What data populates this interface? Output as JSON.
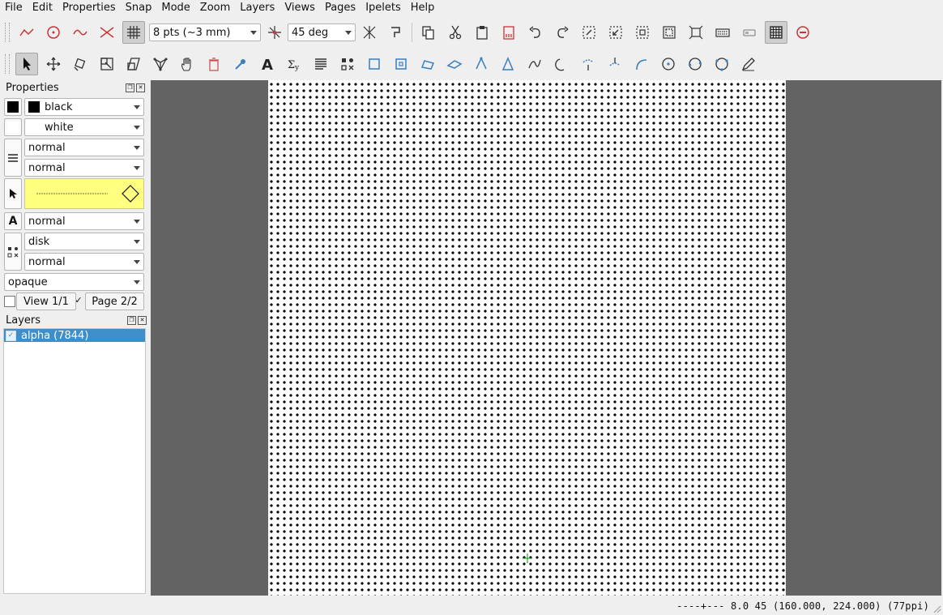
{
  "menu": [
    "File",
    "Edit",
    "Properties",
    "Snap",
    "Mode",
    "Zoom",
    "Layers",
    "Views",
    "Pages",
    "Ipelets",
    "Help"
  ],
  "snap": {
    "grid_size": "8 pts (~3 mm)",
    "angle": "45 deg"
  },
  "toolbar1_icons": [
    "snap-vertex-icon",
    "snap-center-icon",
    "snap-curve-icon",
    "snap-intersection-icon",
    "snap-grid-icon",
    "angular-snap-icon",
    "auto-angle-icon",
    "copy-icon",
    "cut-icon",
    "paste-icon",
    "delete-page-icon",
    "undo-icon",
    "redo-icon",
    "fit-page-icon",
    "zoom-in-icon",
    "zoom-selection-icon",
    "fit-objects-icon",
    "fit-width-icon",
    "keyboard-icon",
    "layout-icon",
    "grid-toggle-icon",
    "zoom-out-icon"
  ],
  "toolbar2_icons": [
    "select-tool-icon",
    "translate-tool-icon",
    "rotate-tool-icon",
    "stretch-tool-icon",
    "shear-tool-icon",
    "graph-tool-icon",
    "pan-tool-icon",
    "shred-tool-icon",
    "picker-tool-icon",
    "text-tool-icon",
    "math-text-tool-icon",
    "paragraph-tool-icon",
    "mark-tool-icon",
    "rectangle-tool-icon",
    "box-tool-icon",
    "parallelogram-tool-icon",
    "lines-tool-icon",
    "polygon-tool-icon",
    "splines-tool-icon",
    "spline-polygon-tool-icon",
    "arc-tool-icon",
    "clockwise-arc-tool-icon",
    "circle-three-point-icon",
    "circle-tool-icon",
    "circle-diameter-icon",
    "ink-tool-icon"
  ],
  "properties": {
    "title": "Properties",
    "stroke": "black",
    "fill": "white",
    "pen": "normal",
    "dash": "normal",
    "text_size": "normal",
    "mark_shape": "disk",
    "mark_size": "normal",
    "opacity": "opaque",
    "view_label": "View 1/1",
    "page_label": "Page 2/2",
    "page_checked": "✓"
  },
  "layers": {
    "title": "Layers",
    "items": [
      {
        "label": "alpha (7844)"
      }
    ]
  },
  "status": "----+---  8.0 45 (160.000, 224.000) (77ppi)",
  "colors": {
    "canvas_bg": "#636363",
    "selection": "#3d8ec9",
    "yellow_preview": "#ffff80"
  }
}
